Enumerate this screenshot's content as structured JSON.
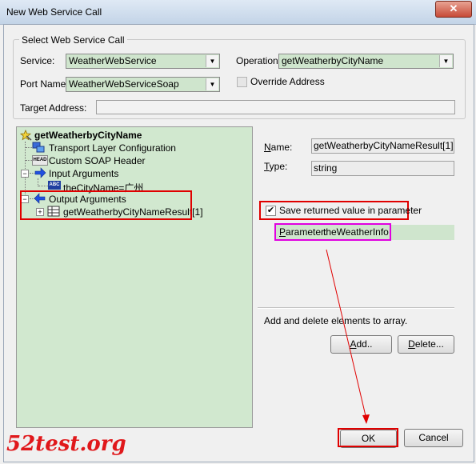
{
  "window": {
    "title": "New Web Service Call",
    "close_glyph": "✕"
  },
  "select_group": {
    "legend": "Select Web Service Call",
    "service_label": "Service:",
    "service_value": "WeatherWebService",
    "operation_label": "Operation:",
    "operation_value": "getWeatherbyCityName",
    "port_label": "Port Name:",
    "port_value": "WeatherWebServiceSoap",
    "override_label": "Override Address",
    "override_checked": false,
    "target_label": "Target Address:",
    "target_value": ""
  },
  "tree": {
    "root": "getWeatherbyCityName",
    "transport": "Transport Layer Configuration",
    "soap_header": "Custom SOAP Header",
    "input_args": "Input Arguments",
    "city_param": "theCityName=广州",
    "output_args": "Output Arguments",
    "output_result": "getWeatherbyCityNameResult[1]",
    "abc_badge": "ABC",
    "head_badge": "HEAD"
  },
  "details": {
    "name_label": "Name:",
    "name_value": "getWeatherbyCityNameResult[1]",
    "type_label": "Type:",
    "type_value": "string",
    "save_label": "Save returned value in parameter",
    "save_checked": true,
    "check_glyph": "✔",
    "parameter_label": "Parameter:",
    "parameter_value": "theWeatherInfo",
    "array_hint": "Add and delete elements to array.",
    "add_button": "Add..",
    "delete_button": "Delete..."
  },
  "footer": {
    "ok_button": "OK",
    "cancel_button": "Cancel"
  },
  "watermark": "52test.org",
  "colors": {
    "field_green": "#cfe5cd",
    "highlight_red": "#e00000",
    "highlight_magenta": "#e000e0",
    "watermark_red": "#e0181b"
  }
}
